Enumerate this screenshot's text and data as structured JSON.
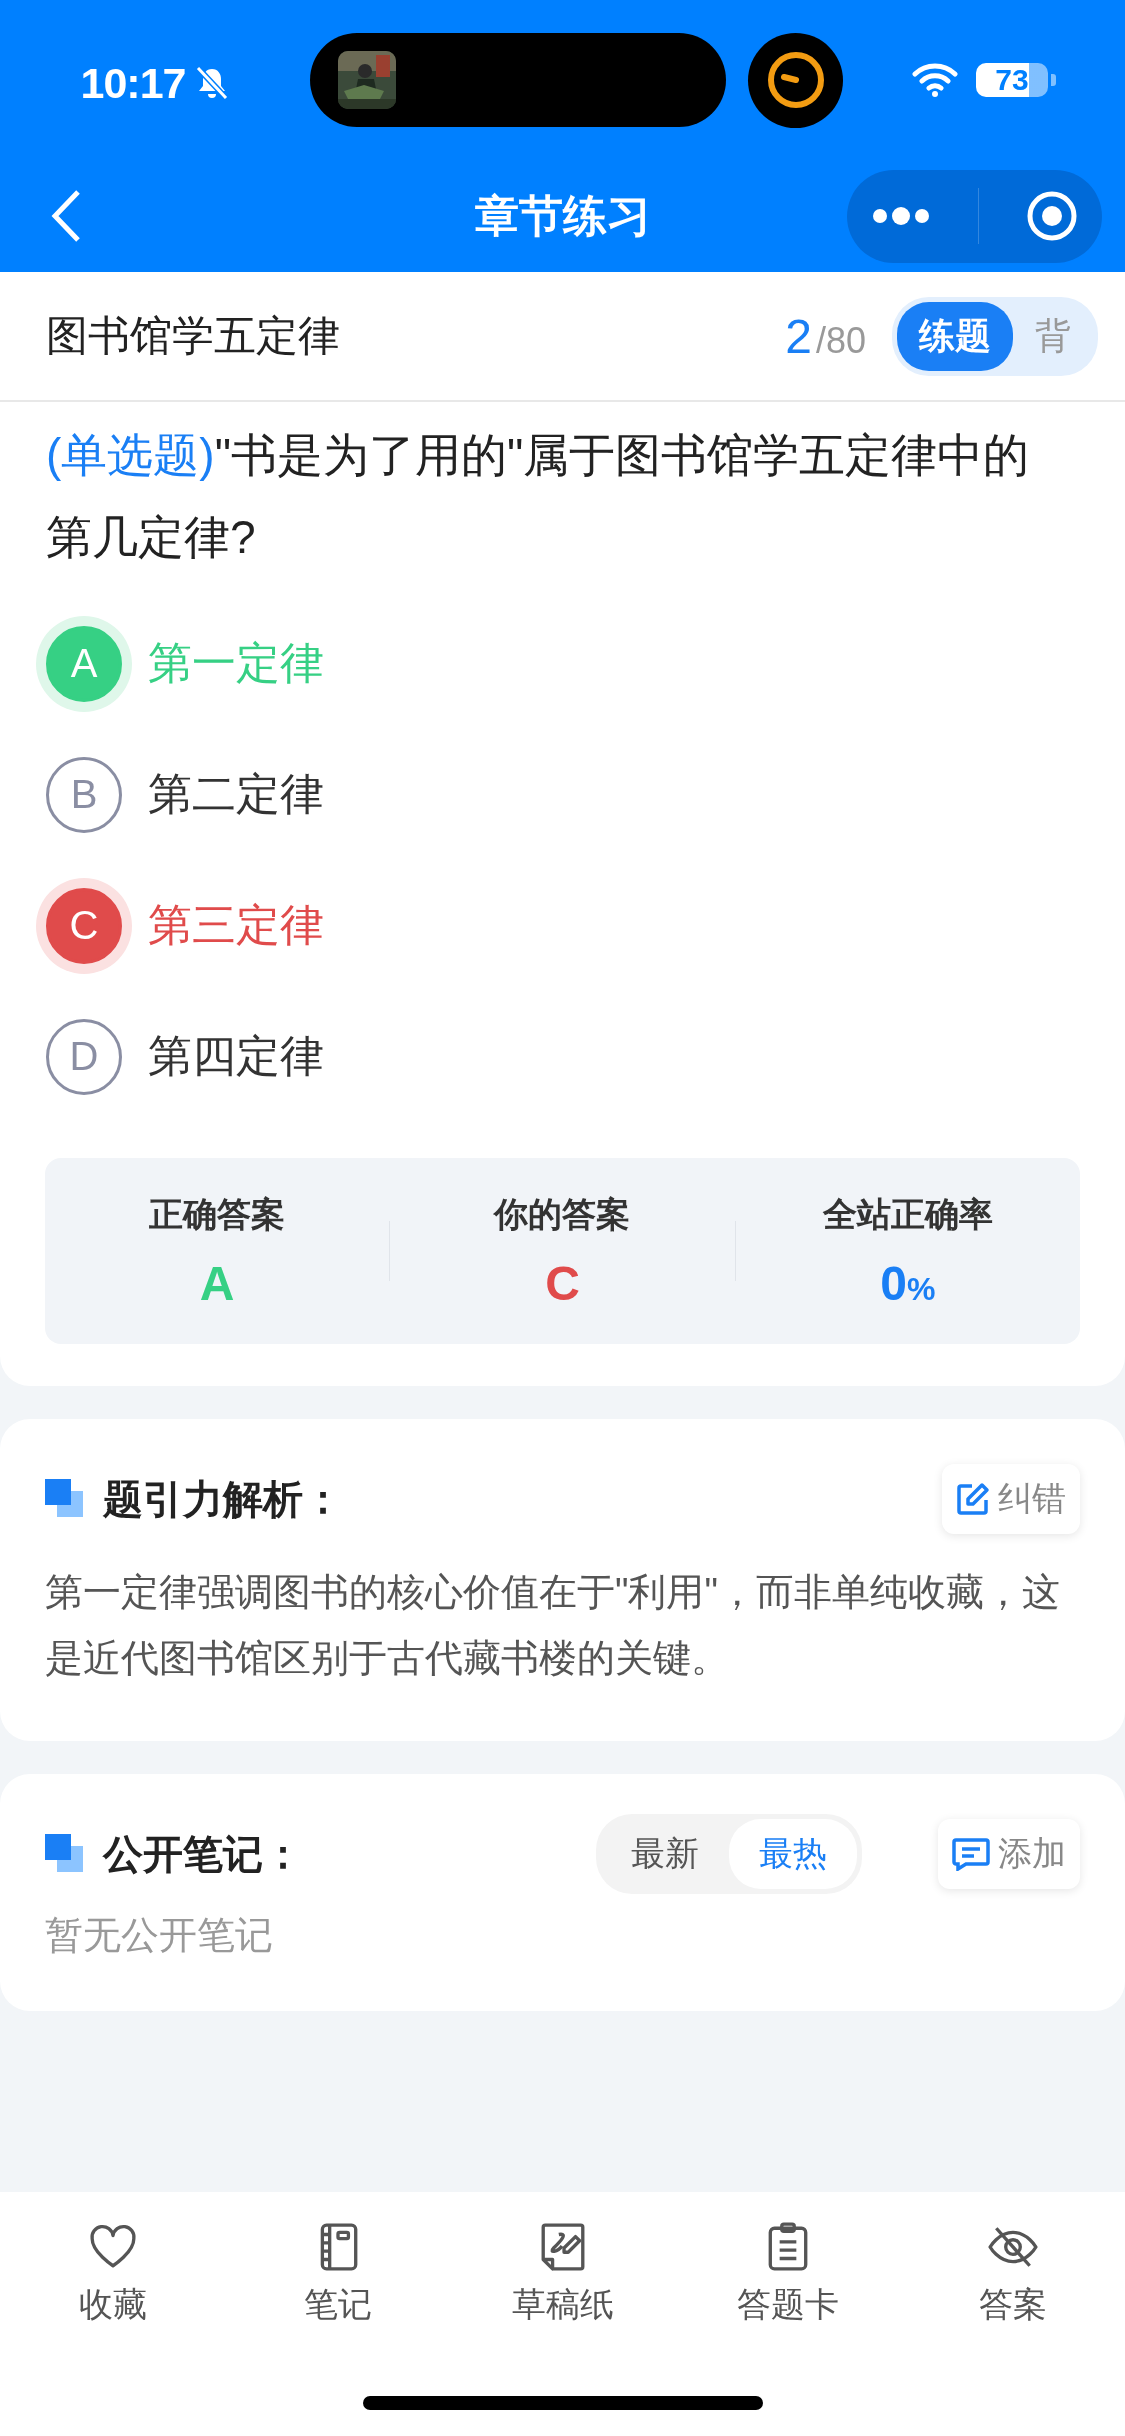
{
  "status_bar": {
    "time": "10:17",
    "battery": "73"
  },
  "nav": {
    "title": "章节练习"
  },
  "header": {
    "chapter": "图书馆学五定律",
    "current": "2",
    "total": "/80",
    "modes": [
      {
        "label": "练题",
        "selected": true
      },
      {
        "label": "背",
        "selected": false
      }
    ]
  },
  "question": {
    "type": "(单选题)",
    "text": "\"书是为了用的\"属于图书馆学五定律中的第几定律?"
  },
  "options": [
    {
      "letter": "A",
      "text": "第一定律",
      "kind": "correct"
    },
    {
      "letter": "B",
      "text": "第二定律",
      "kind": "normal"
    },
    {
      "letter": "C",
      "text": "第三定律",
      "kind": "wrong"
    },
    {
      "letter": "D",
      "text": "第四定律",
      "kind": "normal"
    }
  ],
  "results": [
    {
      "label": "正确答案",
      "value": "A",
      "color": "#36d084"
    },
    {
      "label": "你的答案",
      "value": "C",
      "color": "#e04b4b"
    },
    {
      "label": "全站正确率",
      "value": "0",
      "unit": "%",
      "color": "#1a7ff5"
    }
  ],
  "analysis": {
    "title": "题引力解析：",
    "action": "纠错",
    "text": "第一定律强调图书的核心价值在于\"利用\"，而非单纯收藏，这是近代图书馆区别于古代藏书楼的关键。"
  },
  "notes": {
    "title": "公开笔记：",
    "sorts": [
      {
        "label": "最新",
        "selected": false
      },
      {
        "label": "最热",
        "selected": true
      }
    ],
    "action": "添加",
    "empty": "暂无公开笔记"
  },
  "tabbar": [
    {
      "label": "收藏"
    },
    {
      "label": "笔记"
    },
    {
      "label": "草稿纸"
    },
    {
      "label": "答题卡"
    },
    {
      "label": "答案"
    }
  ]
}
